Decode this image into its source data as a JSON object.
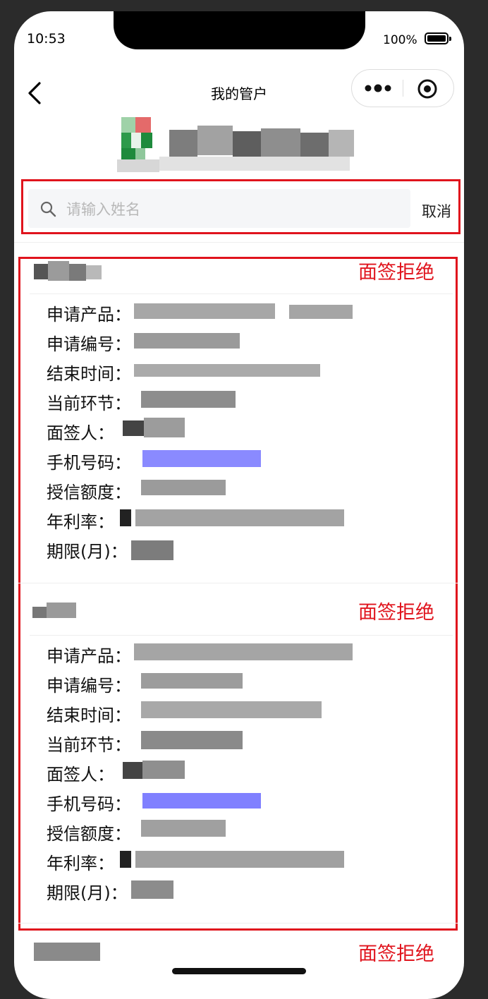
{
  "status_bar": {
    "time": "10:53",
    "battery": "100%"
  },
  "nav": {
    "title": "我的管户"
  },
  "search": {
    "placeholder": "请输入姓名",
    "cancel": "取消"
  },
  "cards": [
    {
      "status": "面签拒绝",
      "fields": [
        {
          "label": "申请产品："
        },
        {
          "label": "申请编号："
        },
        {
          "label": "结束时间："
        },
        {
          "label": "当前环节："
        },
        {
          "label": "面签人："
        },
        {
          "label": "手机号码："
        },
        {
          "label": "授信额度："
        },
        {
          "label": "年利率："
        },
        {
          "label": "期限(月)："
        }
      ]
    },
    {
      "status": "面签拒绝",
      "fields": [
        {
          "label": "申请产品："
        },
        {
          "label": "申请编号："
        },
        {
          "label": "结束时间："
        },
        {
          "label": "当前环节："
        },
        {
          "label": "面签人："
        },
        {
          "label": "手机号码："
        },
        {
          "label": "授信额度："
        },
        {
          "label": "年利率："
        },
        {
          "label": "期限(月)："
        }
      ]
    },
    {
      "status": "面签拒绝"
    }
  ],
  "colors": {
    "accent": "#e0141d",
    "link": "#6b6bff",
    "placeholder": "#b8b8b8"
  }
}
